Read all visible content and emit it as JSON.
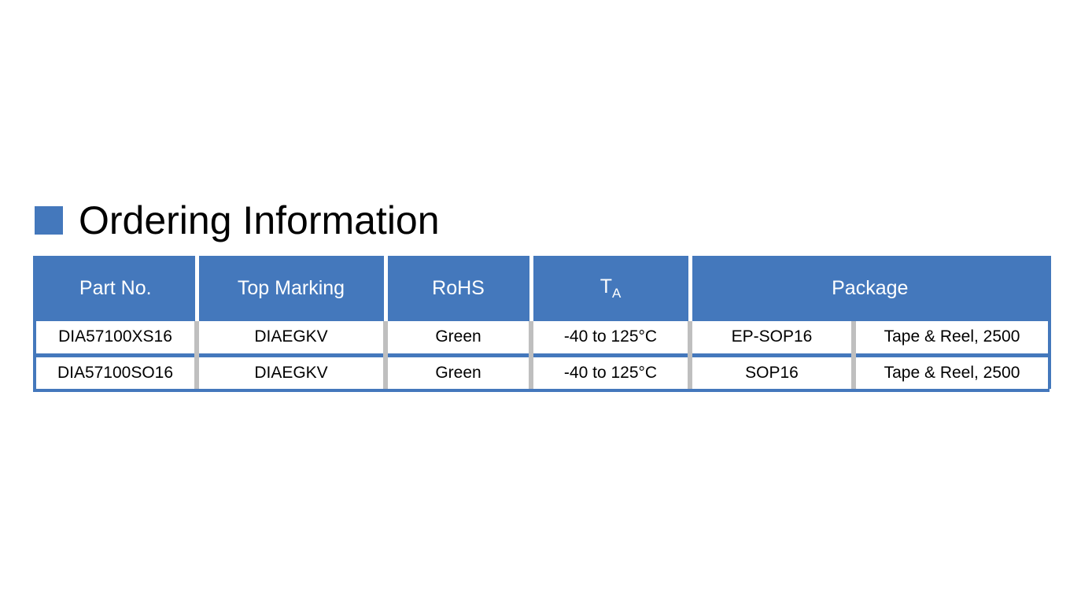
{
  "slide": {
    "title": "Ordering Information",
    "bullet_color": "#4478bc",
    "accent_color": "#4478bc",
    "divider_color": "#bfbfbf",
    "background_color": "#ffffff"
  },
  "table": {
    "headers": [
      {
        "label": "Part No.",
        "sub": ""
      },
      {
        "label": "Top Marking",
        "sub": ""
      },
      {
        "label": "RoHS",
        "sub": ""
      },
      {
        "label": "T",
        "sub": "A"
      },
      {
        "label": "Package",
        "sub": ""
      }
    ],
    "rows": [
      {
        "part_no": "DIA57100XS16",
        "top_marking": "DIAEGKV",
        "rohs": "Green",
        "ta": "-40 to 125°C",
        "package_type": "EP-SOP16",
        "packing": "Tape & Reel, 2500"
      },
      {
        "part_no": "DIA57100SO16",
        "top_marking": "DIAEGKV",
        "rohs": "Green",
        "ta": "-40 to 125°C",
        "package_type": "SOP16",
        "packing": "Tape & Reel, 2500"
      }
    ]
  }
}
